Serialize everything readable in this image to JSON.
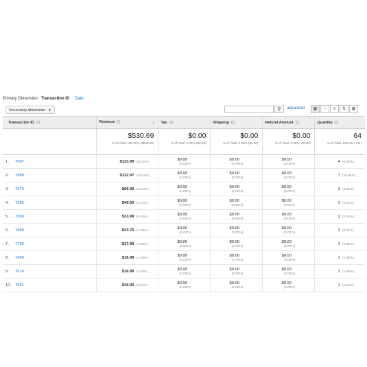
{
  "primary_dimension": {
    "label": "Primary Dimension:",
    "active": "Transaction ID",
    "other": "Date"
  },
  "toolbar": {
    "secondary_dimension": "Secondary dimension",
    "advanced": "advanced"
  },
  "columns": [
    "Transaction ID",
    "Revenue",
    "Tax",
    "Shipping",
    "Refund Amount",
    "Quantity"
  ],
  "totals": {
    "revenue": {
      "value": "$530.69",
      "sub": "% of Total: 100.00% ($530.69)"
    },
    "tax": {
      "value": "$0.00",
      "sub": "% of Total: 0.00% ($0.00)"
    },
    "shipping": {
      "value": "$0.00",
      "sub": "% of Total: 0.00% ($0.00)"
    },
    "refund": {
      "value": "$0.00",
      "sub": "% of Total: 0.00% ($0.00)"
    },
    "quantity": {
      "value": "64",
      "sub": "% of Total: 100.00% (64)"
    }
  },
  "rows": [
    {
      "idx": "1.",
      "id": "7687",
      "rev": "$123.99",
      "rev_pct": "(23.36%)",
      "tax": "$0.00",
      "tax_pct": "(0.00%)",
      "ship": "$0.00",
      "ship_pct": "(0.00%)",
      "ref": "$0.00",
      "ref_pct": "(0.00%)",
      "qty": "4",
      "qty_pct": "(6.25%)"
    },
    {
      "idx": "2.",
      "id": "7688",
      "rev": "$122.97",
      "rev_pct": "(23.17%)",
      "tax": "$0.00",
      "tax_pct": "(0.00%)",
      "ship": "$0.00",
      "ship_pct": "(0.00%)",
      "ref": "$0.00",
      "ref_pct": "(0.00%)",
      "qty": "7",
      "qty_pct": "(10.94%)"
    },
    {
      "idx": "3.",
      "id": "7679",
      "rev": "$66.99",
      "rev_pct": "(12.62%)",
      "tax": "$0.00",
      "tax_pct": "(0.00%)",
      "ship": "$0.00",
      "ship_pct": "(0.00%)",
      "ref": "$0.00",
      "ref_pct": "(0.00%)",
      "qty": "3",
      "qty_pct": "(4.69%)"
    },
    {
      "idx": "4.",
      "id": "7685",
      "rev": "$49.00",
      "rev_pct": "(9.23%)",
      "tax": "$0.00",
      "tax_pct": "(0.00%)",
      "ship": "$0.00",
      "ship_pct": "(0.00%)",
      "ref": "$0.00",
      "ref_pct": "(0.00%)",
      "qty": "2",
      "qty_pct": "(3.12%)"
    },
    {
      "idx": "5.",
      "id": "7699",
      "rev": "$33.99",
      "rev_pct": "(6.40%)",
      "tax": "$0.00",
      "tax_pct": "(0.00%)",
      "ship": "$0.00",
      "ship_pct": "(0.00%)",
      "ref": "$0.00",
      "ref_pct": "(0.00%)",
      "qty": "2",
      "qty_pct": "(3.12%)"
    },
    {
      "idx": "6.",
      "id": "7689",
      "rev": "$23.75",
      "rev_pct": "(4.48%)",
      "tax": "$0.00",
      "tax_pct": "(0.00%)",
      "ship": "$0.00",
      "ship_pct": "(0.00%)",
      "ref": "$0.00",
      "ref_pct": "(0.00%)",
      "qty": "2",
      "qty_pct": "(3.12%)"
    },
    {
      "idx": "7.",
      "id": "7705",
      "rev": "$17.99",
      "rev_pct": "(3.39%)",
      "tax": "$0.00",
      "tax_pct": "(0.00%)",
      "ship": "$0.00",
      "ship_pct": "(0.00%)",
      "ref": "$0.00",
      "ref_pct": "(0.00%)",
      "qty": "1",
      "qty_pct": "(1.56%)"
    },
    {
      "idx": "8.",
      "id": "7660",
      "rev": "$16.99",
      "rev_pct": "(3.20%)",
      "tax": "$0.00",
      "tax_pct": "(0.00%)",
      "ship": "$0.00",
      "ship_pct": "(0.00%)",
      "ref": "$0.00",
      "ref_pct": "(0.00%)",
      "qty": "1",
      "qty_pct": "(1.56%)"
    },
    {
      "idx": "9.",
      "id": "7674",
      "rev": "$16.99",
      "rev_pct": "(3.20%)",
      "tax": "$0.00",
      "tax_pct": "(0.00%)",
      "ship": "$0.00",
      "ship_pct": "(0.00%)",
      "ref": "$0.00",
      "ref_pct": "(0.00%)",
      "qty": "1",
      "qty_pct": "(1.56%)"
    },
    {
      "idx": "10.",
      "id": "7691",
      "rev": "$16.00",
      "rev_pct": "(3.01%)",
      "tax": "$0.00",
      "tax_pct": "(0.00%)",
      "ship": "$0.00",
      "ship_pct": "(0.00%)",
      "ref": "$0.00",
      "ref_pct": "(0.00%)",
      "qty": "1",
      "qty_pct": "(1.56%)"
    }
  ],
  "icons": {
    "search": "search-icon",
    "views": [
      "table-view-icon",
      "pie-view-icon",
      "performance-view-icon",
      "comparison-view-icon",
      "pivot-view-icon"
    ]
  },
  "colors": {
    "link": "#1a73c8",
    "header_bg": "#eeeeee"
  }
}
